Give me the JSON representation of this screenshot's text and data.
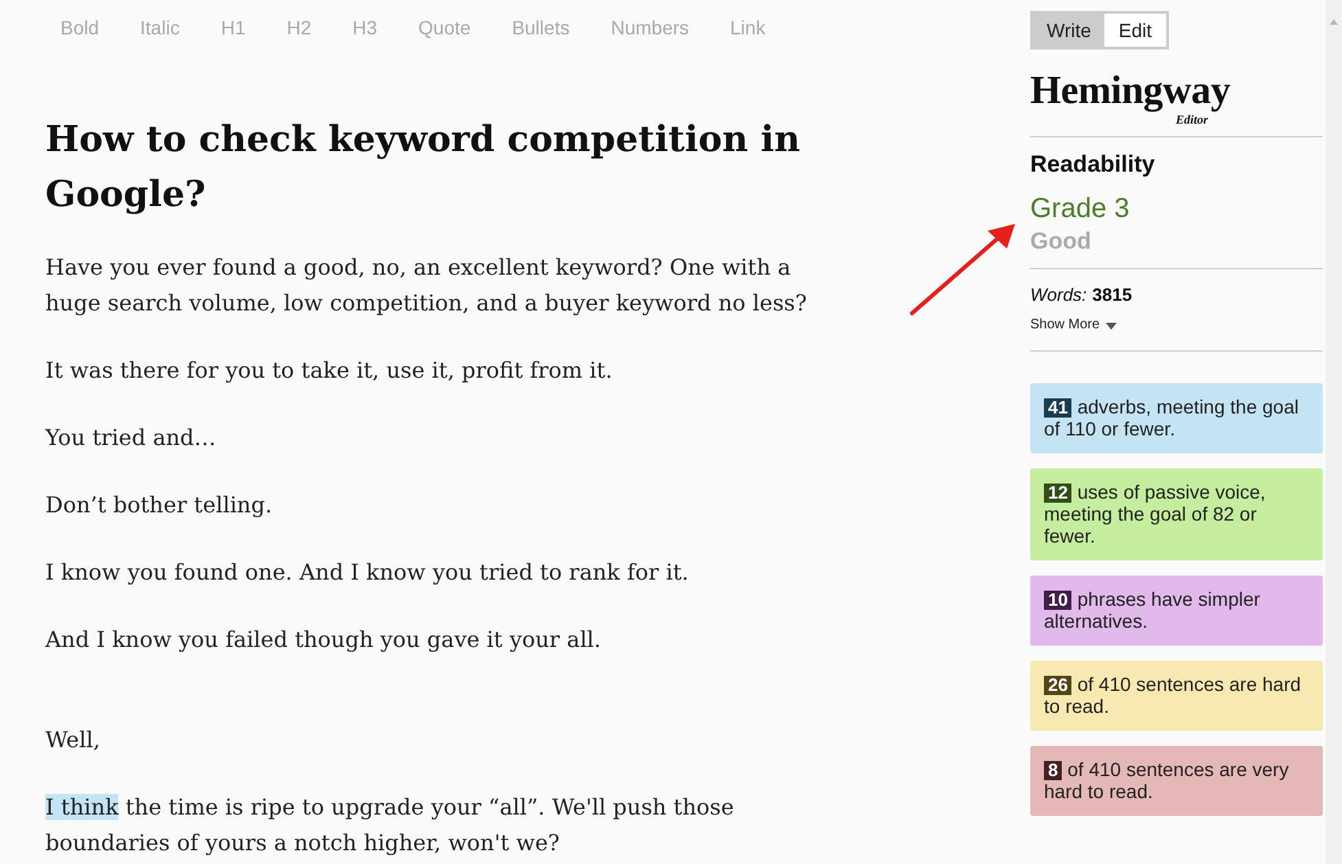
{
  "toolbar": [
    "Bold",
    "Italic",
    "H1",
    "H2",
    "H3",
    "Quote",
    "Bullets",
    "Numbers",
    "Link"
  ],
  "document": {
    "title": "How to check keyword competition in Google?",
    "paragraphs": [
      {
        "kind": "text",
        "segments": [
          {
            "text": "Have you ever found a good, no, an excellent keyword? One with a huge search volume, low competition, and a buyer keyword no less?",
            "highlighted": false
          }
        ]
      },
      {
        "kind": "text",
        "segments": [
          {
            "text": "It was there for you to take it, use it, profit from it.",
            "highlighted": false
          }
        ]
      },
      {
        "kind": "text",
        "segments": [
          {
            "text": "You tried and…",
            "highlighted": false
          }
        ]
      },
      {
        "kind": "text",
        "segments": [
          {
            "text": "Don’t bother telling.",
            "highlighted": false
          }
        ]
      },
      {
        "kind": "text",
        "segments": [
          {
            "text": "I know you found one. And I know you tried to rank for it.",
            "highlighted": false
          }
        ]
      },
      {
        "kind": "text",
        "segments": [
          {
            "text": "And I know you failed though you gave it your all.",
            "highlighted": false
          }
        ]
      },
      {
        "kind": "blank"
      },
      {
        "kind": "text",
        "segments": [
          {
            "text": "Well,",
            "highlighted": false
          }
        ]
      },
      {
        "kind": "text",
        "segments": [
          {
            "text": "I think",
            "highlighted": true
          },
          {
            "text": " the time is ripe to upgrade your “all”. We'll push those boundaries of yours a notch higher, won't we?",
            "highlighted": false
          }
        ]
      }
    ]
  },
  "sidebar": {
    "mode_toggle": [
      {
        "label": "Write",
        "selected": true
      },
      {
        "label": "Edit",
        "selected": false
      }
    ],
    "logo": {
      "name": "Hemingway",
      "subtitle": "Editor"
    },
    "readability": {
      "heading": "Readability",
      "grade": "Grade 3",
      "rating": "Good"
    },
    "stats": {
      "words_label": "Words:",
      "words": "3815",
      "show_more": "Show More"
    },
    "suggestions": [
      {
        "count": "41",
        "text": "adverbs, meeting the goal of 110 or fewer.",
        "color": "#c4e3f3"
      },
      {
        "count": "12",
        "text": "uses of passive voice, meeting the goal of 82 or fewer.",
        "color": "#c4ed9d"
      },
      {
        "count": "10",
        "text": "phrases have simpler alternatives.",
        "color": "#e1b9eb"
      },
      {
        "count": "26",
        "text": "of 410 sentences are hard to read.",
        "color": "#f8e9b3"
      },
      {
        "count": "8",
        "text": "of 410 sentences are very hard to read.",
        "color": "#e5b8b8"
      }
    ]
  }
}
